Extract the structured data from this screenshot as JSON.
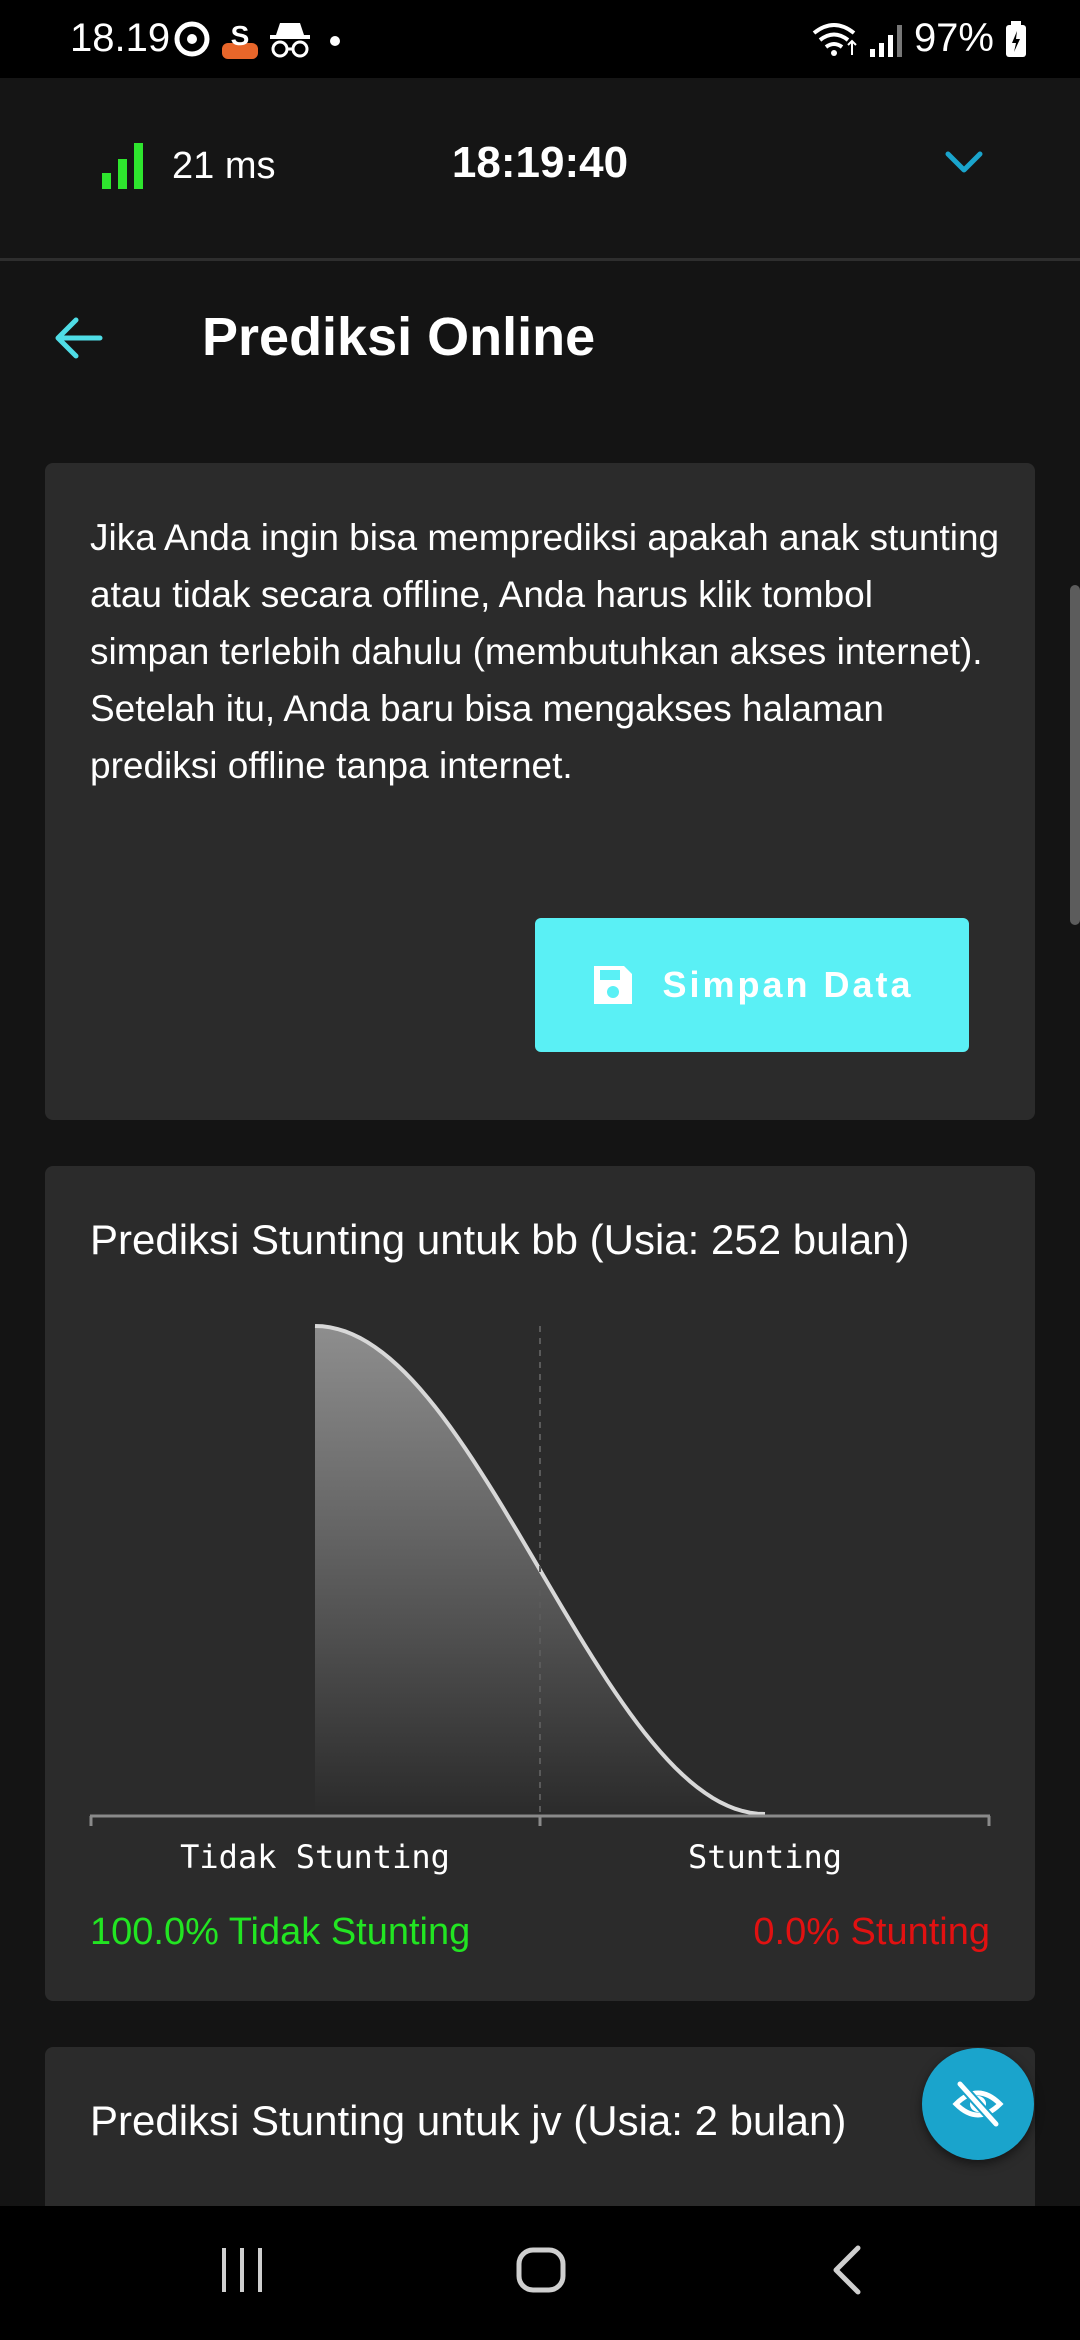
{
  "status_bar": {
    "time": "18.19",
    "battery": "97%",
    "left_icons": [
      "location-icon",
      "s-app-icon",
      "incognito-icon",
      "dot-icon"
    ],
    "right_icons": [
      "wifi-icon",
      "signal-icon",
      "battery-icon"
    ]
  },
  "topbar": {
    "ping": "21 ms",
    "clock": "18:19:40",
    "signal_color": "#2ee52e",
    "chevron_color": "#1aa4cc"
  },
  "header": {
    "title": "Prediksi Online"
  },
  "info_card": {
    "text": "Jika Anda ingin bisa memprediksi apakah anak stunting atau tidak secara offline, Anda harus klik tombol simpan terlebih dahulu (membutuhkan akses internet). Setelah itu, Anda baru bisa mengakses halaman prediksi offline tanpa internet.",
    "button_label": "Simpan Data",
    "button_color": "#5af0f5"
  },
  "prediction_card": {
    "title": "Prediksi Stunting untuk bb (Usia: 252 bulan)",
    "left_label": "100.0% Tidak Stunting",
    "right_label": "0.0% Stunting",
    "left_color": "#22e522",
    "right_color": "#e11111"
  },
  "chart_data": {
    "type": "area",
    "categories": [
      "Tidak Stunting",
      "Stunting"
    ],
    "values": [
      100.0,
      0.0
    ],
    "title": "",
    "xlabel": "",
    "ylabel": "",
    "grid": false,
    "legend": "none"
  },
  "prediction_card_2": {
    "title": "Prediksi Stunting untuk jv (Usia: 2 bulan)"
  },
  "fab": {
    "icon": "eye-off-icon",
    "color": "#1aa4cc"
  },
  "navbar": {
    "icons": [
      "recents-icon",
      "home-icon",
      "back-icon"
    ]
  }
}
